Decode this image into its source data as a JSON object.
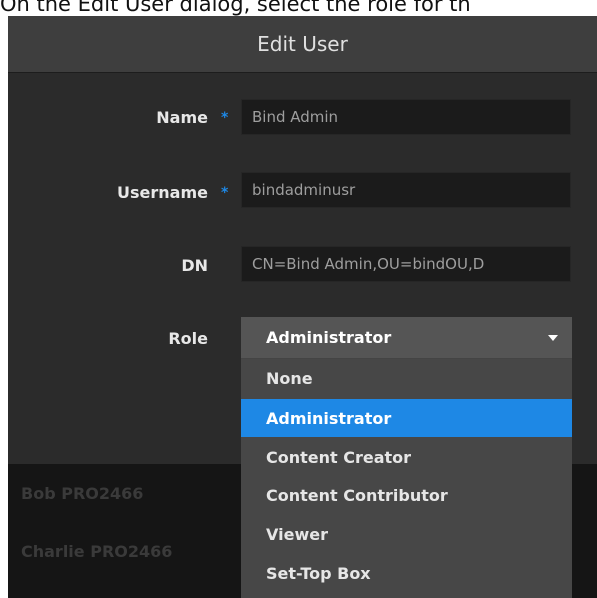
{
  "caption": "On the Edit User dialog, select the role for th",
  "dialog": {
    "title": "Edit User",
    "fields": {
      "name": {
        "label": "Name",
        "required_mark": "*",
        "value": "Bind Admin"
      },
      "username": {
        "label": "Username",
        "required_mark": "*",
        "value": "bindadminusr"
      },
      "dn": {
        "label": "DN",
        "value": "CN=Bind Admin,OU=bindOU,D"
      },
      "role": {
        "label": "Role",
        "selected": "Administrator"
      }
    },
    "role_options": [
      "None",
      "Administrator",
      "Content Creator",
      "Content Contributor",
      "Viewer",
      "Set-Top Box"
    ]
  },
  "background_list": [
    "Bob PRO2466",
    "Charlie PRO2466"
  ],
  "colors": {
    "accent": "#1e88e5",
    "dialog_bg": "#2b2b2b",
    "header_bg": "#3e3e3e"
  }
}
